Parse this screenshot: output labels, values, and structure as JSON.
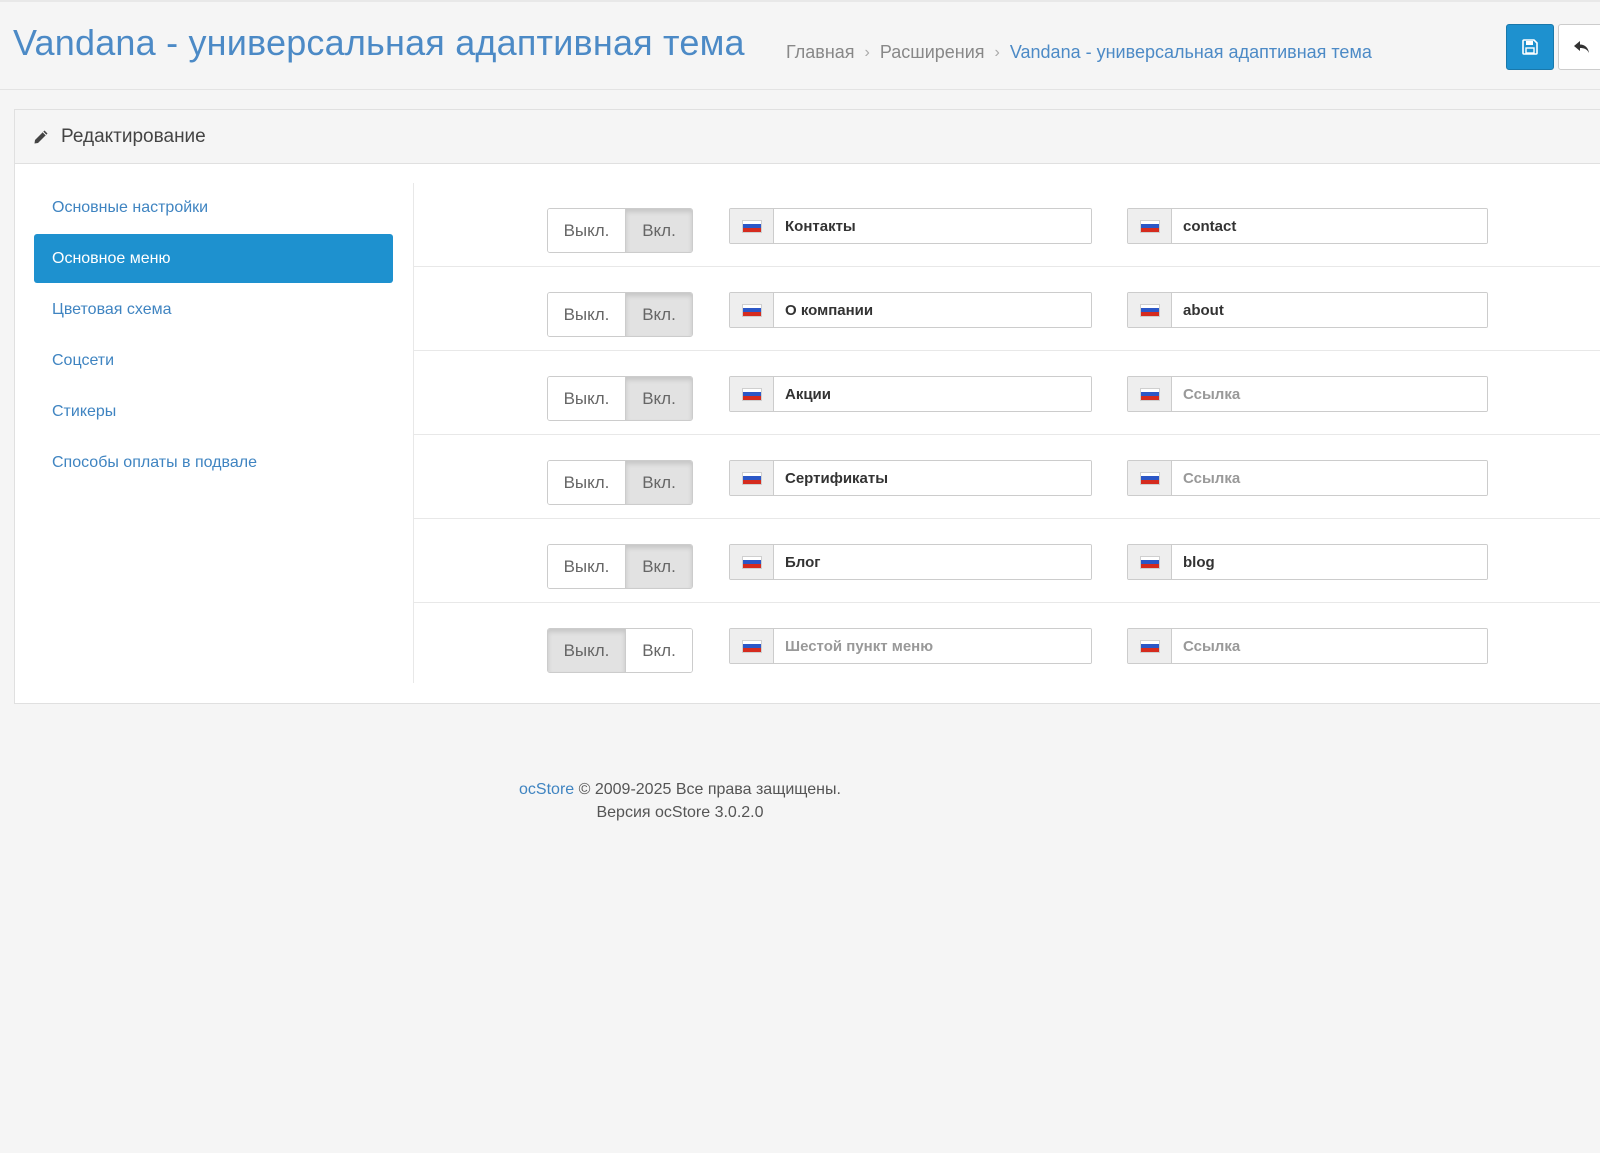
{
  "header": {
    "title": "Vandana - универсальная адаптивная тема",
    "breadcrumb": [
      {
        "label": "Главная"
      },
      {
        "label": "Расширения"
      },
      {
        "label": "Vandana - универсальная адаптивная тема"
      }
    ],
    "save_icon": "save-icon",
    "back_icon": "reply-icon"
  },
  "panel": {
    "title": "Редактирование",
    "icon": "pencil-icon"
  },
  "sidebar": {
    "items": [
      {
        "label": "Основные настройки",
        "active": false
      },
      {
        "label": "Основное меню",
        "active": true
      },
      {
        "label": "Цветовая схема",
        "active": false
      },
      {
        "label": "Соцсети",
        "active": false
      },
      {
        "label": "Стикеры",
        "active": false
      },
      {
        "label": "Способы оплаты в подвале",
        "active": false
      }
    ]
  },
  "toggle_labels": {
    "off": "Выкл.",
    "on": "Вкл."
  },
  "menu_rows": [
    {
      "enabled": true,
      "title": "Контакты",
      "title_placeholder": "",
      "link": "contact",
      "link_placeholder": "Ссылка"
    },
    {
      "enabled": true,
      "title": "О компании",
      "title_placeholder": "",
      "link": "about",
      "link_placeholder": "Ссылка"
    },
    {
      "enabled": true,
      "title": "Акции",
      "title_placeholder": "",
      "link": "",
      "link_placeholder": "Ссылка"
    },
    {
      "enabled": true,
      "title": "Сертификаты",
      "title_placeholder": "",
      "link": "",
      "link_placeholder": "Ссылка"
    },
    {
      "enabled": true,
      "title": "Блог",
      "title_placeholder": "",
      "link": "blog",
      "link_placeholder": "Ссылка"
    },
    {
      "enabled": false,
      "title": "",
      "title_placeholder": "Шестой пункт меню",
      "link": "",
      "link_placeholder": "Ссылка"
    }
  ],
  "colors": {
    "accent": "#1e91cf",
    "link": "#3f84c1",
    "title": "#4c8ac6"
  },
  "footer": {
    "brand": "ocStore",
    "copyright": "© 2009-2025 Все права защищены.",
    "version": "Версия ocStore 3.0.2.0"
  }
}
